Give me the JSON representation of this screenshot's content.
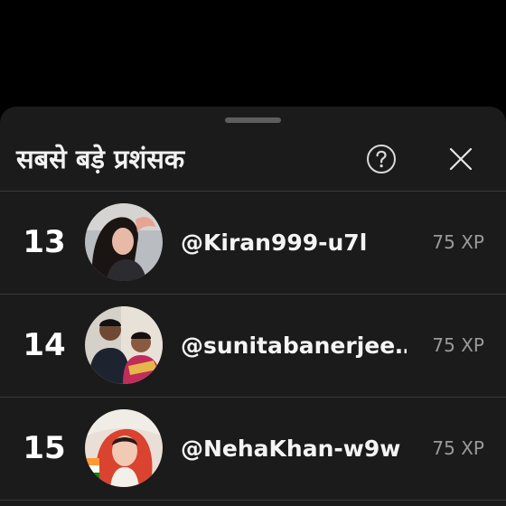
{
  "sheet": {
    "title": "सबसे बड़े प्रशंसक",
    "help_icon": "help-circle-icon",
    "close_icon": "close-icon"
  },
  "fans": [
    {
      "rank": "13",
      "username": "@Kiran999-u7l",
      "xp": "75 XP",
      "avatar_icon": "user-avatar"
    },
    {
      "rank": "14",
      "username": "@sunitabanerjee…",
      "xp": "75 XP",
      "avatar_icon": "user-avatar"
    },
    {
      "rank": "15",
      "username": "@NehaKhan-w9w",
      "xp": "75 XP",
      "avatar_icon": "user-avatar"
    }
  ],
  "colors": {
    "background": "#000000",
    "sheet": "#1b1b1b",
    "divider": "#3a3a3a",
    "text_primary": "#f4f4f4",
    "text_secondary": "#9a9a9a"
  }
}
